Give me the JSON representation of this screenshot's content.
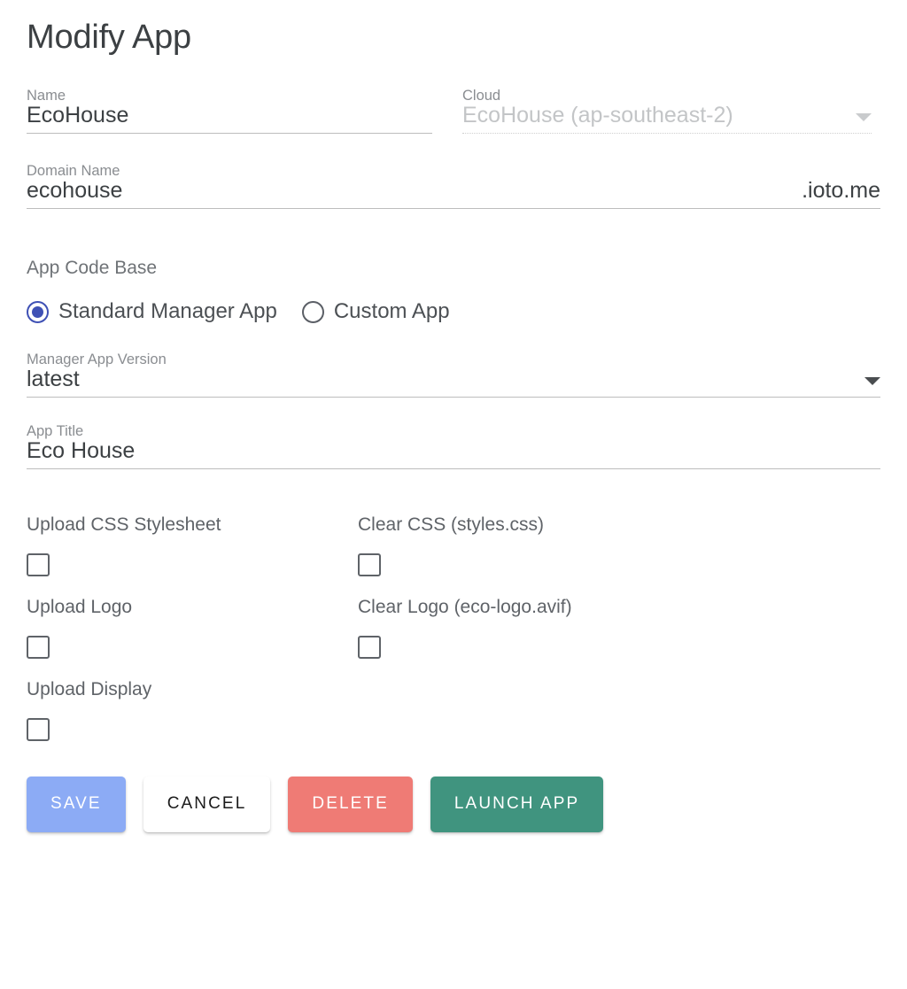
{
  "page": {
    "title": "Modify App"
  },
  "fields": {
    "name": {
      "label": "Name",
      "value": "EcoHouse"
    },
    "cloud": {
      "label": "Cloud",
      "value": "EcoHouse (ap-southeast-2)",
      "disabled_state": "disabled",
      "icon": "chevron-down-icon"
    },
    "domain": {
      "label": "Domain Name",
      "value": "ecohouse",
      "suffix": ".ioto.me"
    },
    "manager_version": {
      "label": "Manager App Version",
      "value": "latest",
      "icon": "chevron-down-icon"
    },
    "app_title": {
      "label": "App Title",
      "value": "Eco House"
    }
  },
  "app_code_base": {
    "label": "App Code Base",
    "options": [
      {
        "label": "Standard Manager App",
        "selected": true
      },
      {
        "label": "Custom App",
        "selected": false
      }
    ]
  },
  "checkboxes": [
    {
      "label": "Upload CSS Stylesheet",
      "checked": false
    },
    {
      "label": "Clear CSS (styles.css)",
      "checked": false
    },
    {
      "label": "Upload Logo",
      "checked": false
    },
    {
      "label": "Clear Logo (eco-logo.avif)",
      "checked": false
    },
    {
      "label": "Upload Display",
      "checked": false
    }
  ],
  "buttons": [
    {
      "label": "SAVE",
      "color": "#8cabf5"
    },
    {
      "label": "CANCEL",
      "color": "#ffffff"
    },
    {
      "label": "DELETE",
      "color": "#ef7b75"
    },
    {
      "label": "LAUNCH APP",
      "color": "#40947f"
    }
  ],
  "colors": {
    "accent_radio": "#3f51b5",
    "underline": "#bdbdbd",
    "label_gray": "#8a8d91",
    "text": "#3c4043"
  }
}
